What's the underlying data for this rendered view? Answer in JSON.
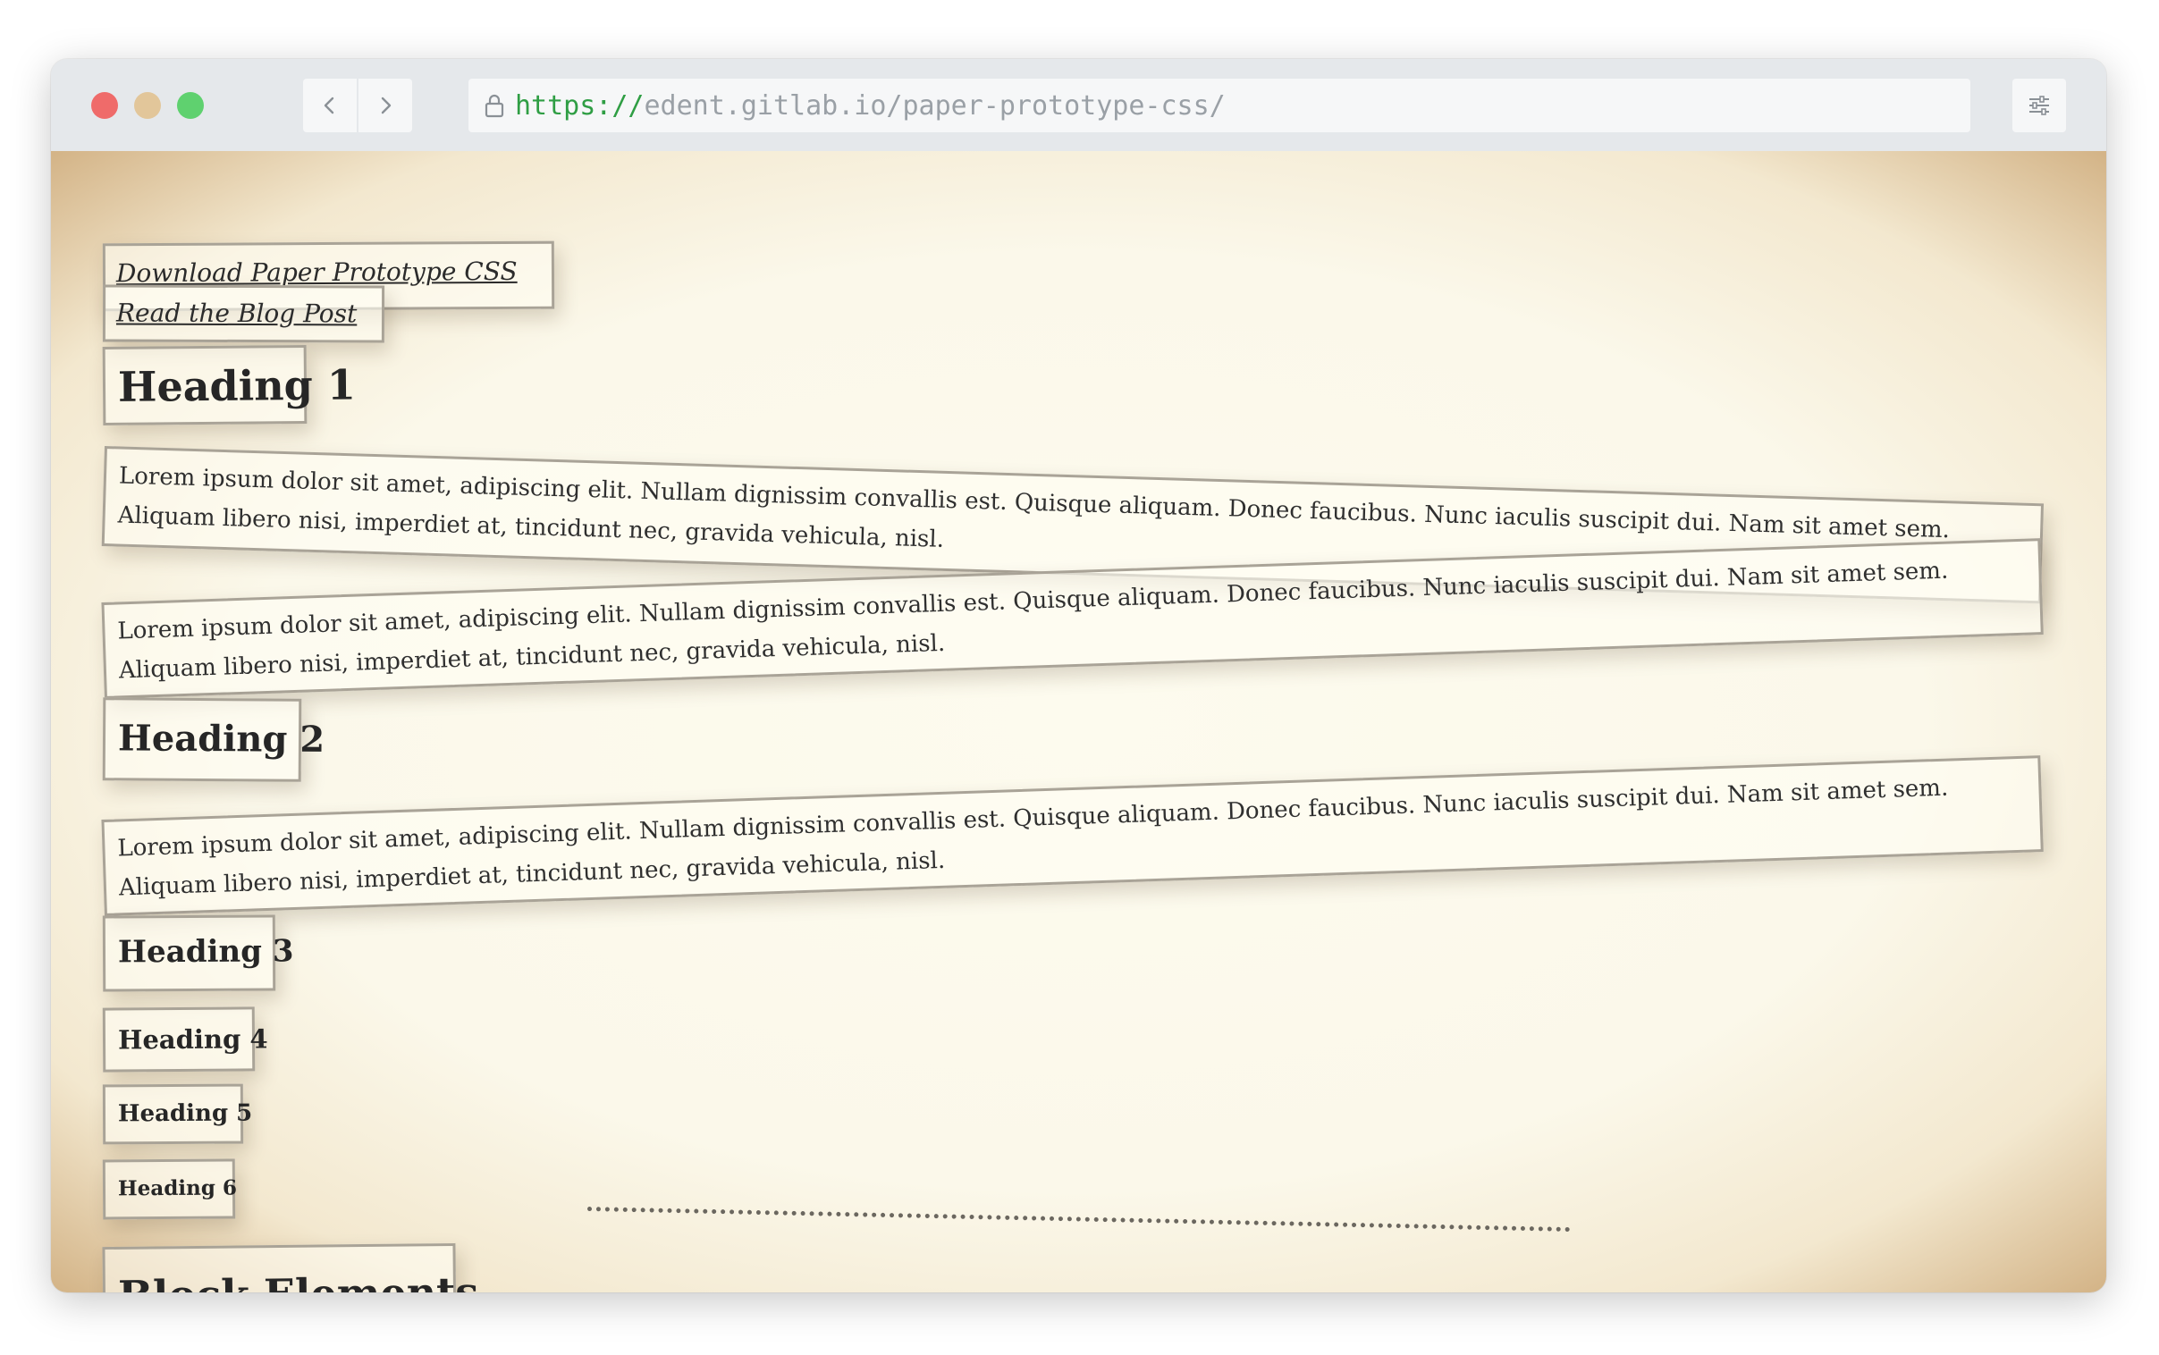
{
  "browser": {
    "url_scheme": "https://",
    "url_rest": "edent.gitlab.io/paper-prototype-css/",
    "controls": {
      "back_icon": "chevron-left-icon",
      "forward_icon": "chevron-right-icon",
      "lock_icon": "lock-icon",
      "settings_icon": "sliders-icon"
    },
    "colors": {
      "close": "#ef6b6a",
      "minimize": "#e2c69a",
      "maximize": "#5fd16f",
      "url_scheme": "#2f9e44"
    }
  },
  "page": {
    "links": [
      "Download Paper Prototype CSS",
      "Read the Blog Post"
    ],
    "headings": {
      "h1": "Heading 1",
      "h2": "Heading 2",
      "h3": "Heading 3",
      "h4": "Heading 4",
      "h5": "Heading 5",
      "h6": "Heading 6",
      "block_elements": "Block Elements"
    },
    "paragraph_text": "Lorem ipsum dolor sit amet, adipiscing elit. Nullam dignissim convallis est. Quisque aliquam. Donec faucibus. Nunc iaculis suscipit dui. Nam sit amet sem. Aliquam libero nisi, imperdiet at, tincidunt nec, gravida vehicula, nisl.",
    "paragraphs": [
      "Lorem ipsum dolor sit amet, adipiscing elit. Nullam dignissim convallis est. Quisque aliquam. Donec faucibus. Nunc iaculis suscipit dui. Nam sit amet sem. Aliquam libero nisi, imperdiet at, tincidunt nec, gravida vehicula, nisl.",
      "Lorem ipsum dolor sit amet, adipiscing elit. Nullam dignissim convallis est. Quisque aliquam. Donec faucibus. Nunc iaculis suscipit dui. Nam sit amet sem. Aliquam libero nisi, imperdiet at, tincidunt nec, gravida vehicula, nisl.",
      "Lorem ipsum dolor sit amet, adipiscing elit. Nullam dignissim convallis est. Quisque aliquam. Donec faucibus. Nunc iaculis suscipit dui. Nam sit amet sem. Aliquam libero nisi, imperdiet at, tincidunt nec, gravida vehicula, nisl."
    ]
  }
}
